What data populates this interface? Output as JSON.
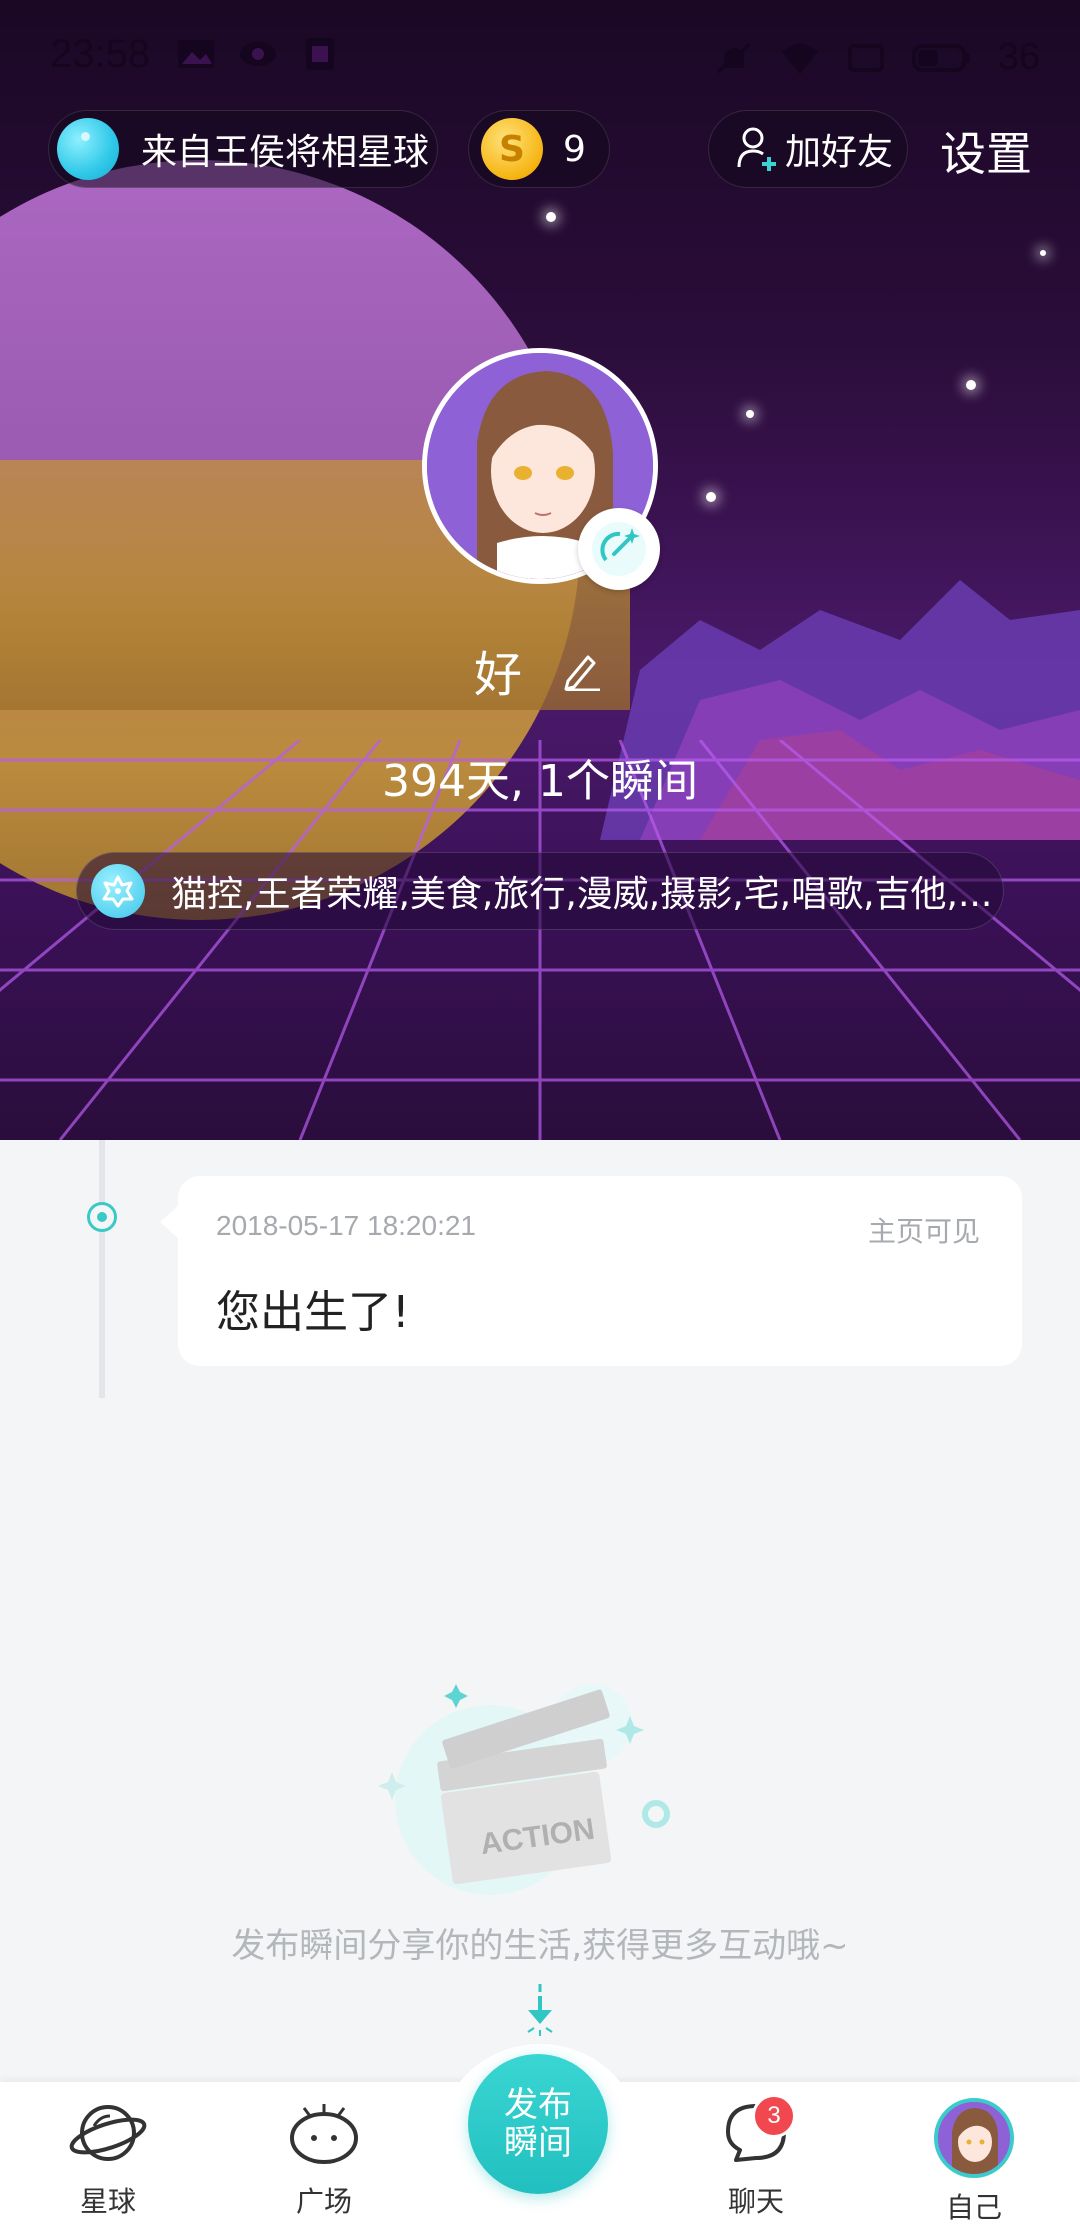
{
  "status_bar": {
    "time": "23:58",
    "battery": "36"
  },
  "header": {
    "planet_label": "来自王侯将相星球",
    "coin_symbol": "S",
    "coins": "9",
    "add_friend_label": "加好友",
    "settings_label": "设置"
  },
  "profile": {
    "name": "好",
    "stats": "394天, 1个瞬间",
    "interests": "猫控,王者荣耀,美食,旅行,漫威,摄影,宅,唱歌,吉他,..."
  },
  "timeline": {
    "items": [
      {
        "time": "2018-05-17 18:20:21",
        "visibility": "主页可见",
        "text": "您出生了!"
      }
    ]
  },
  "empty_state": {
    "illustration_text": "ACTION",
    "text": "发布瞬间分享你的生活,获得更多互动哦~"
  },
  "bottom_nav": {
    "planet_label": "星球",
    "square_label": "广场",
    "publish_line1": "发布",
    "publish_line2": "瞬间",
    "chat_label": "聊天",
    "chat_badge": "3",
    "self_label": "自己"
  },
  "colors": {
    "accent": "#2fc6c4",
    "badge": "#f0484e",
    "page_bg": "#f4f5f7"
  },
  "icons": [
    "planet-ball-icon",
    "coin-icon",
    "add-friend-icon",
    "magic-wand-icon",
    "edit-pencil-icon",
    "tags-icon",
    "timeline-dot-icon",
    "clapperboard-illustration",
    "down-arrow-icon",
    "planet-nav-icon",
    "square-nav-icon",
    "chat-nav-icon"
  ]
}
